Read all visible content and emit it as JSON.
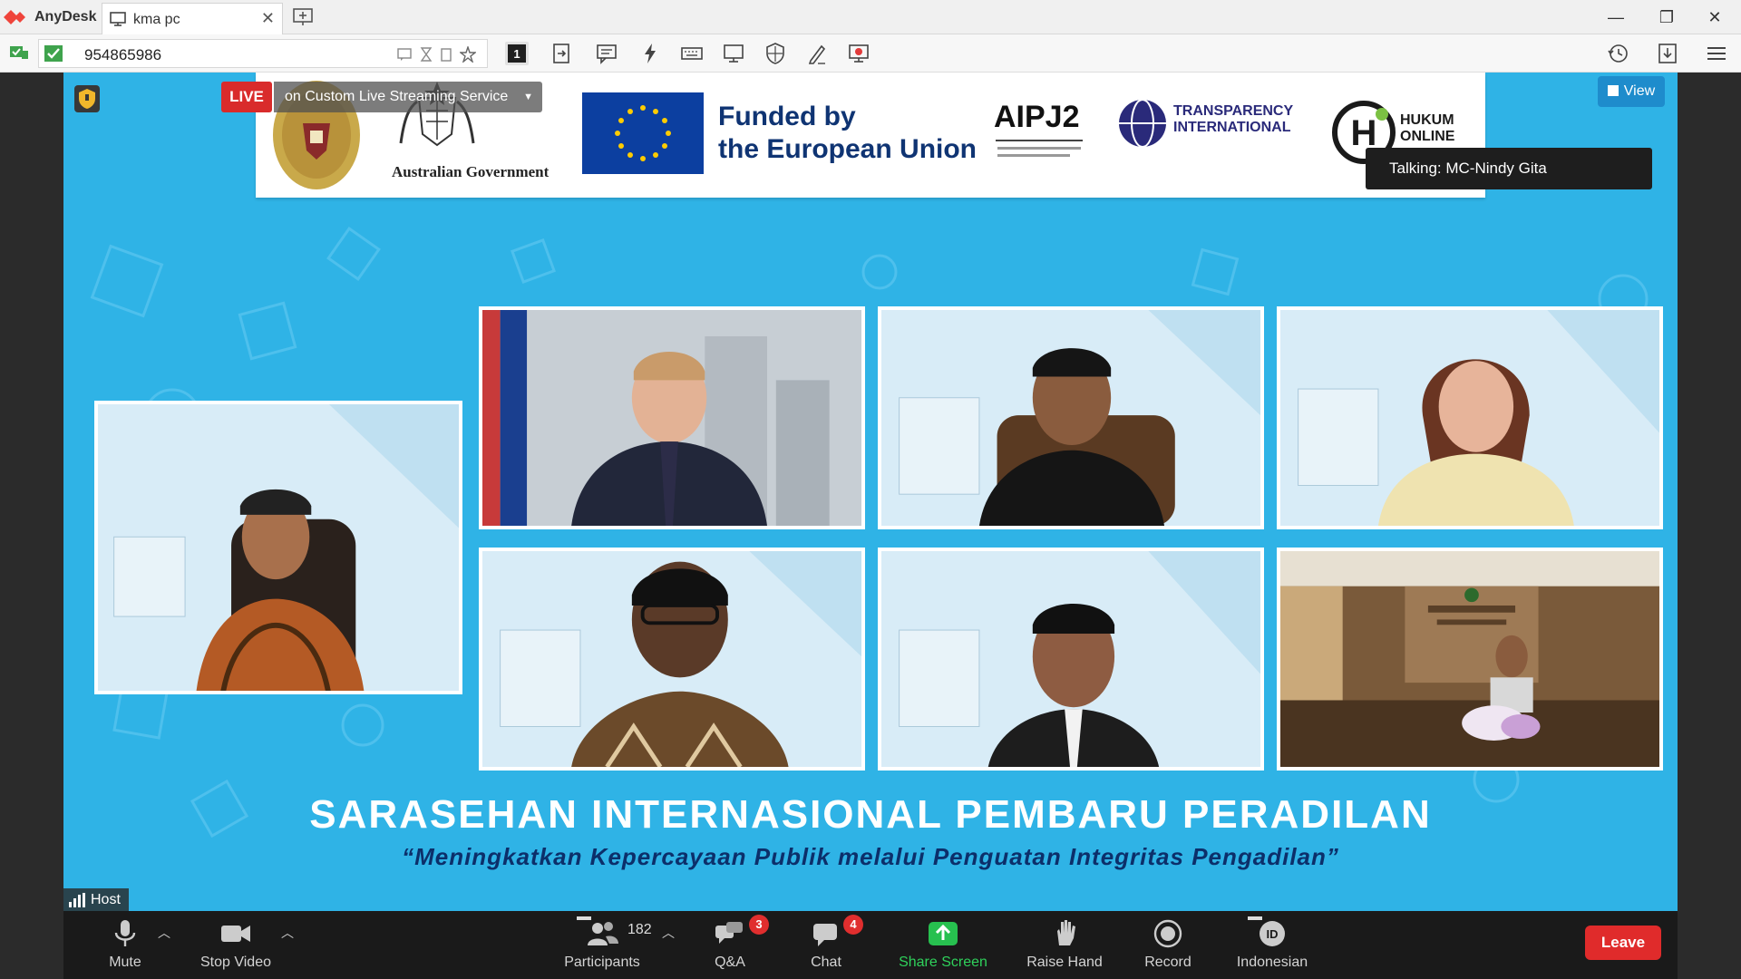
{
  "anydesk": {
    "app_name": "AnyDesk",
    "tab_label": "kma pc",
    "address": "954865986",
    "colors": {
      "brand": "#ef443b"
    }
  },
  "meeting": {
    "live_badge": "LIVE",
    "stream_label": "on Custom Live Streaming Service",
    "view_label": "View",
    "talking": "Talking: MC-Nindy Gita",
    "sponsor": {
      "australian_gov": "Australian Government",
      "funded_line1": "Funded by",
      "funded_line2": "the European Union",
      "aipj2": "AIPJ2",
      "transparency_line1": "TRANSPARENCY",
      "transparency_line2": "INTERNATIONAL",
      "hukum_line1": "HUKUM",
      "hukum_line2": "ONLINE"
    },
    "headline": "SARASEHAN INTERNASIONAL PEMBARU PERADILAN",
    "subline": "“Meningkatkan Kepercayaan Publik melalui Penguatan Integritas Pengadilan”",
    "host_label": "Host",
    "colors": {
      "background": "#2fb3e6",
      "accent": "#0e72ed"
    }
  },
  "controls": {
    "mute": "Mute",
    "stop_video": "Stop Video",
    "participants": "Participants",
    "participants_count": "182",
    "qa": "Q&A",
    "qa_badge": "3",
    "chat": "Chat",
    "chat_badge": "4",
    "share_screen": "Share Screen",
    "raise_hand": "Raise Hand",
    "record": "Record",
    "language": "Indonesian",
    "language_code": "ID",
    "leave": "Leave"
  }
}
